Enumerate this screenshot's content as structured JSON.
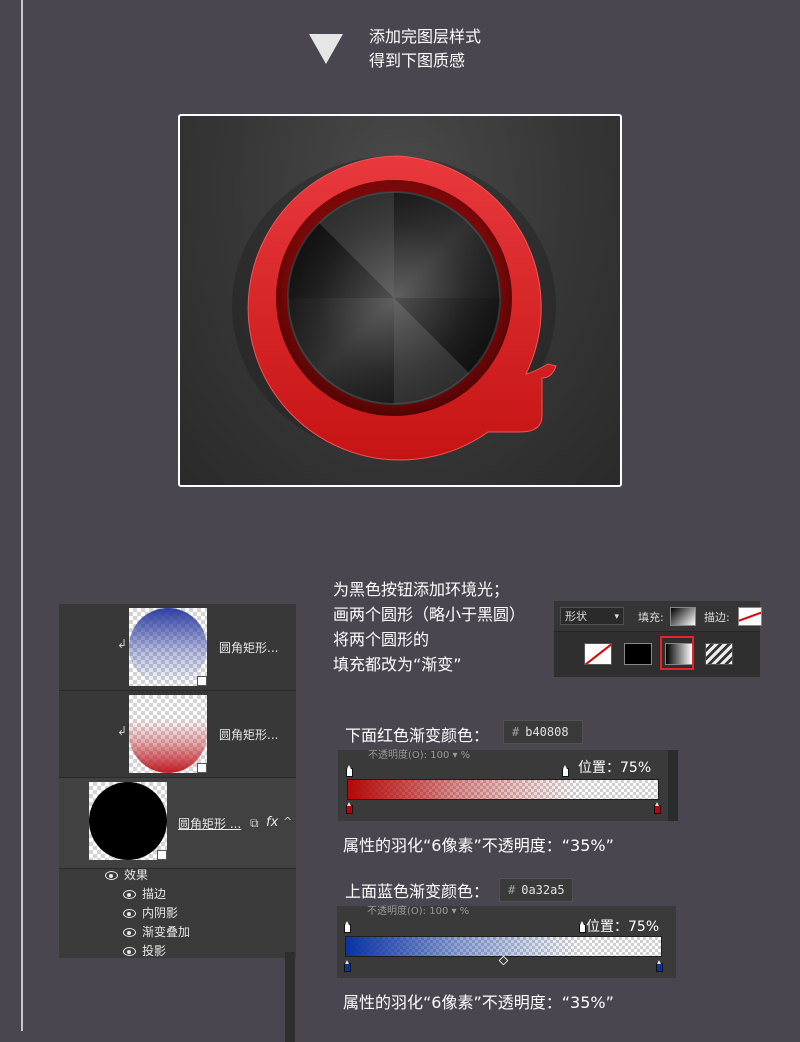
{
  "step": {
    "title_line1": "添加完图层样式",
    "title_line2": "得到下图质感"
  },
  "instructions": {
    "line1": "为黑色按钮添加环境光；",
    "line2": "画两个圆形（略小于黑圆）",
    "line3": "将两个圆形的",
    "line4": "填充都改为“渐变”"
  },
  "layers_panel": {
    "layers": [
      {
        "name": "圆角矩形...",
        "thumb_color": "#0a32a5"
      },
      {
        "name": "圆角矩形...",
        "thumb_color": "#b40808"
      },
      {
        "name": "圆角矩形 ...",
        "thumb_color": "#000000"
      }
    ],
    "fx_label": "fx",
    "effects_header": "效果",
    "effects": [
      "描边",
      "内阴影",
      "渐变叠加",
      "投影"
    ]
  },
  "options_bar": {
    "shape_mode": "形状",
    "fill_label": "填充:",
    "stroke_label": "描边:"
  },
  "red_gradient": {
    "heading": "下面红色渐变颜色：",
    "hex": "b40808",
    "hash": "#",
    "opacity_label": "不透明度(O): 100 ▾ %",
    "position_label": "位置：75%",
    "color": "#b40808",
    "transparent_stop_percent": 75
  },
  "red_properties": "属性的羽化“6像素”不透明度：“35%”",
  "blue_gradient": {
    "heading": "上面蓝色渐变颜色：",
    "hex": "0a32a5",
    "hash": "#",
    "opacity_label": "不透明度(O): 100 ▾ %",
    "position_label": "位置：75%",
    "color": "#0a32a5",
    "transparent_stop_percent": 75
  },
  "blue_properties": "属性的羽化“6像素”不透明度：“35%”",
  "colors": {
    "background": "#49464f",
    "accent_red": "#d92020",
    "highlight_border": "#e82323"
  }
}
